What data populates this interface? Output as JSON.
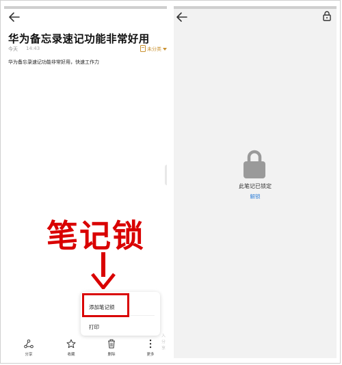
{
  "left_screen": {
    "note_title": "华为备忘录速记功能非常好用",
    "date": "今天",
    "time": "14:43",
    "folder": "未分类",
    "body": "华为备忘录速记功能非常好用，快速工作力",
    "annotation_label": "笔记锁",
    "menu": {
      "add_lock": "添加笔记锁",
      "print": "打印"
    },
    "hint": "入 分享",
    "toolbar": {
      "share": "分享",
      "favorite": "收藏",
      "delete": "删除",
      "more": "更多"
    },
    "accent_colors": {
      "annotation": "#d90000",
      "folder": "#c9912f"
    }
  },
  "right_screen": {
    "locked_message": "此笔记已锁定",
    "unlock": "解锁",
    "link_color": "#2f7fd8"
  },
  "icons": [
    "back-arrow-icon",
    "folder-icon",
    "down-arrow-icon",
    "share-icon",
    "star-icon",
    "trash-icon",
    "more-icon",
    "lock-icon"
  ]
}
